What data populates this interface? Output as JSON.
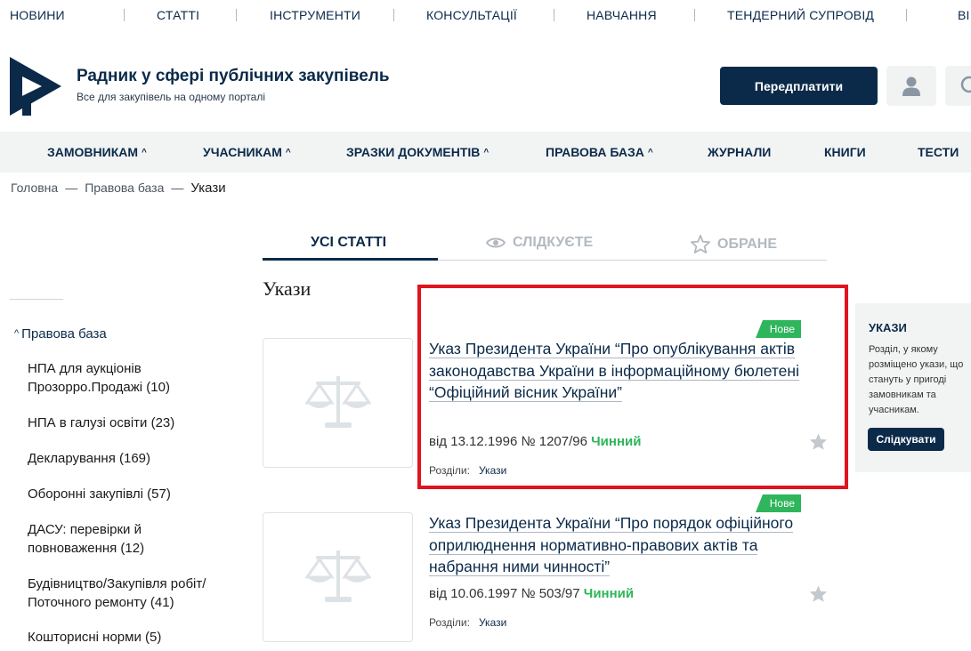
{
  "topnav": {
    "items": [
      "НОВИНИ",
      "СТАТТІ",
      "ІНСТРУМЕНТИ",
      "КОНСУЛЬТАЦІЇ",
      "НАВЧАННЯ",
      "ТЕНДЕРНИЙ СУПРОВІД",
      "ВІ"
    ]
  },
  "header": {
    "title": "Радник у сфері публічних закупівель",
    "subtitle": "Все для закупівель на одному порталі",
    "subscribe_label": "Передплатити",
    "user_icon": "user-icon",
    "search_icon": "search-icon"
  },
  "mainnav": {
    "items": [
      "ЗАМОВНИКАМ",
      "УЧАСНИКАМ",
      "ЗРАЗКИ ДОКУМЕНТІВ",
      "ПРАВОВА БАЗА",
      "ЖУРНАЛИ",
      "КНИГИ",
      "ТЕСТИ"
    ],
    "caret": "^"
  },
  "breadcrumb": {
    "items": [
      "Головна",
      "Правова база",
      "Укази"
    ],
    "separator": "—"
  },
  "sidebar": {
    "heading": "Правова база",
    "caret": "^",
    "items": [
      "НПА для аукціонів Прозорро.Продажі (10)",
      "НПА в галузі освіти (23)",
      "Декларування (169)",
      "Оборонні закупівлі (57)",
      "ДАСУ: перевірки й повноваження (12)",
      "Будівництво/Закупівля робіт/ Поточного ремонту (41)",
      "Кошторисні норми (5)"
    ]
  },
  "tabs": {
    "items": [
      "УСІ СТАТТІ",
      "СЛІДКУЄТЕ",
      "ОБРАНЕ"
    ],
    "active": "УСІ СТАТТІ"
  },
  "page_heading": "Укази",
  "articles": [
    {
      "badge": "Нове",
      "title": "Указ Президента України “Про опублікування актів законодавства України в інформаційному бюлетені “Офіційний вісник України”",
      "meta": "від 13.12.1996 № 1207/96",
      "status": "Чинний",
      "sections_label": "Розділи:",
      "section": "Укази"
    },
    {
      "badge": "Нове",
      "title": "Указ Президента України “Про порядок офіційного оприлюднення нормативно-правових актів та набрання ними чинності”",
      "meta": "від 10.06.1997 № 503/97",
      "status": "Чинний",
      "sections_label": "Розділи:",
      "section": "Укази"
    }
  ],
  "info_panel": {
    "title": "УКАЗИ",
    "text": "Розділ, у якому розміщено укази, що стануть у пригоді замовникам та учасникам.",
    "button_label": "Слідкувати"
  },
  "colors": {
    "brand": "#0b2a4a",
    "accent_green": "#2fb55b",
    "highlight_red": "#e0141e",
    "panel_bg": "#f2f4f4"
  }
}
